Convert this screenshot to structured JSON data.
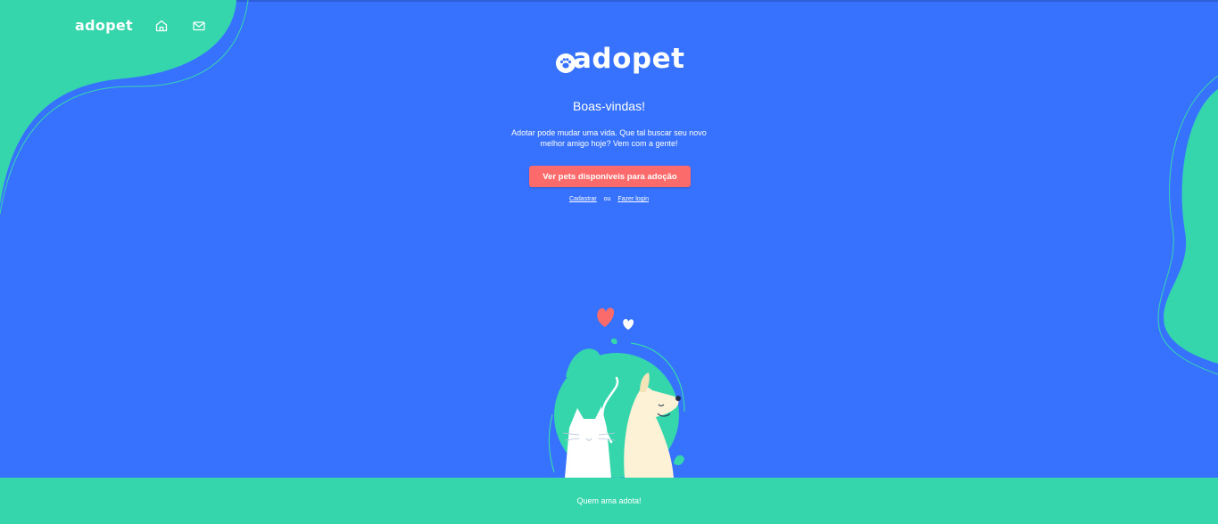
{
  "nav": {
    "logo": "adopet",
    "home_icon": "home-icon",
    "mail_icon": "mail-icon"
  },
  "hero": {
    "logo": "adopet",
    "title": "Boas-vindas!",
    "subtitle": "Adotar pode mudar uma vida. Que tal buscar seu novo melhor amigo hoje? Vem com a gente!",
    "cta_label": "Ver pets disponíveis para adoção",
    "register_link": "Cadastrar",
    "or_text": "ou",
    "login_link": "Fazer login"
  },
  "footer": {
    "text": "Quem ama adota!"
  },
  "colors": {
    "background": "#3772ff",
    "accent_green": "#36d6ad",
    "button": "#fc6b6b",
    "text": "#ffffff"
  }
}
